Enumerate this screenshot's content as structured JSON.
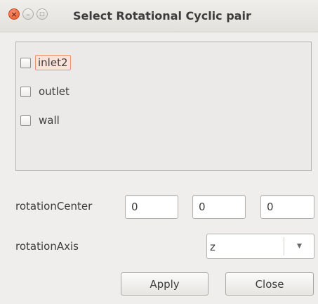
{
  "window": {
    "title": "Select Rotational Cyclic pair",
    "close_glyph": "×",
    "min_glyph": "–",
    "max_glyph": "□"
  },
  "patches": [
    {
      "label": "inlet2",
      "checked": false,
      "focused": true
    },
    {
      "label": "outlet",
      "checked": false,
      "focused": false
    },
    {
      "label": "wall",
      "checked": false,
      "focused": false
    }
  ],
  "rotationCenter": {
    "label": "rotationCenter",
    "values": [
      "0",
      "0",
      "0"
    ]
  },
  "rotationAxis": {
    "label": "rotationAxis",
    "value": "z",
    "arrow": "▼"
  },
  "buttons": {
    "apply": "Apply",
    "close": "Close"
  },
  "colors": {
    "focus_border": "#e8956f",
    "close_button": "#e4572a"
  }
}
